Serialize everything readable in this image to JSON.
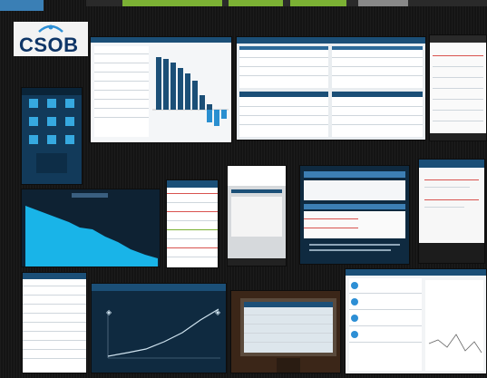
{
  "logo": {
    "text": "CSOB"
  },
  "colors": {
    "brand_navy": "#0e3567",
    "app_blue": "#1b4f77",
    "chart_cyan": "#19b4e8",
    "accent_green": "#7bb134",
    "accent_red": "#d9534f"
  },
  "gallery": {
    "tiles": [
      {
        "name": "tile-phone-menu",
        "kind": "phone-app-grid"
      },
      {
        "name": "tile-tablet-bar-chart",
        "kind": "tablet-bar-chart"
      },
      {
        "name": "tile-tablet-list-split",
        "kind": "tablet-list"
      },
      {
        "name": "tile-phone-messages",
        "kind": "phone-list"
      },
      {
        "name": "tile-area-chart",
        "kind": "tablet-area-chart"
      },
      {
        "name": "tile-phone-table",
        "kind": "phone-table"
      },
      {
        "name": "tile-phone-form",
        "kind": "phone-form"
      },
      {
        "name": "tile-phone-dialog",
        "kind": "phone-dialog"
      },
      {
        "name": "tile-phone-notes",
        "kind": "phone-notes"
      },
      {
        "name": "tile-tablet-rates",
        "kind": "tablet-table"
      },
      {
        "name": "tile-line-chart",
        "kind": "tablet-line-chart"
      },
      {
        "name": "tile-monitor-photo",
        "kind": "photo"
      },
      {
        "name": "tile-tablet-news",
        "kind": "tablet-news"
      }
    ]
  }
}
